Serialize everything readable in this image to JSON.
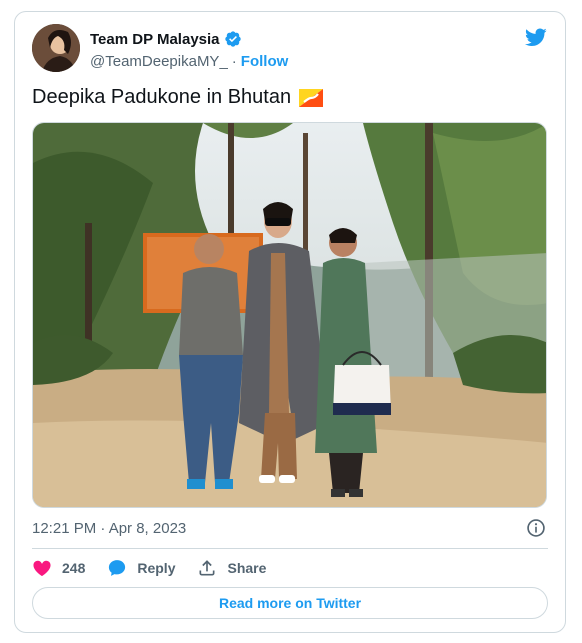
{
  "tweet": {
    "author_name": "Team DP Malaysia",
    "handle": "@TeamDeepikaMY_",
    "separator": "·",
    "follow_label": "Follow",
    "text": "Deepika Padukone in Bhutan",
    "timestamp": "12:21 PM · Apr 8, 2023",
    "like_count": "248",
    "reply_label": "Reply",
    "share_label": "Share",
    "read_more_label": "Read more on Twitter"
  },
  "colors": {
    "accent": "#1d9bf0",
    "like": "#f91880",
    "muted_text": "#536471",
    "border": "#cfd9de"
  },
  "icons": [
    "verified-badge-icon",
    "twitter-bird-icon",
    "bhutan-flag-icon",
    "info-icon",
    "heart-icon",
    "reply-bubble-icon",
    "share-icon"
  ]
}
